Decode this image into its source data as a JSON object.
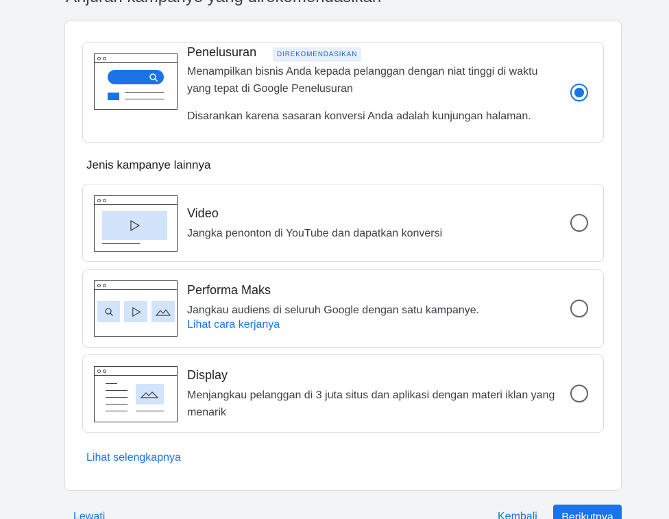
{
  "page": {
    "title": "Anjuran kampanye yang direkomendasikan"
  },
  "recommended": {
    "title": "Penelusuran",
    "badge": "DIREKOMENDASIKAN",
    "description": "Menampilkan bisnis Anda kepada pelanggan dengan niat tinggi di waktu yang tepat di Google Penelusuran",
    "reason": "Disarankan karena sasaran konversi Anda adalah kunjungan halaman.",
    "selected": true
  },
  "other_section": {
    "label": "Jenis kampanye lainnya"
  },
  "options": [
    {
      "title": "Video",
      "description": "Jangka penonton di YouTube dan dapatkan konversi",
      "selected": false
    },
    {
      "title": "Performa Maks",
      "description": "Jangkau audiens di seluruh Google dengan satu kampanye.",
      "link": "Lihat cara kerjanya",
      "selected": false
    },
    {
      "title": "Display",
      "description": "Menjangkau pelanggan di 3 juta situs dan aplikasi dengan materi iklan yang menarik",
      "selected": false
    }
  ],
  "see_more": "Lihat selengkapnya",
  "footer": {
    "skip": "Lewati",
    "back": "Kembali",
    "next": "Berikutnya"
  },
  "colors": {
    "accent": "#1a73e8",
    "thumb_fill": "#d2e3fc",
    "badge_bg": "#e8f0fe"
  }
}
